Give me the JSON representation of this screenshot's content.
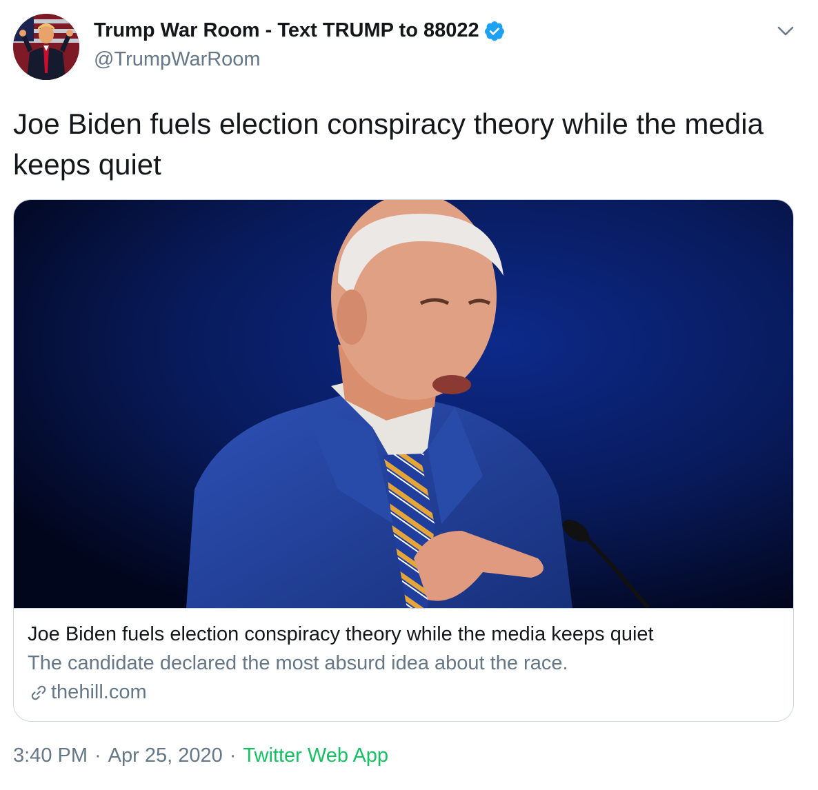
{
  "author": {
    "name": "Trump War Room - Text TRUMP to 88022",
    "handle": "@TrumpWarRoom",
    "verified": true
  },
  "icons": {
    "verified": "verified-badge-icon",
    "caret": "chevron-down-icon",
    "link": "link-icon"
  },
  "tweet": {
    "text": "Joe Biden fuels election conspiracy theory while the media keeps quiet"
  },
  "card": {
    "title": "Joe Biden fuels election conspiracy theory while the media keeps quiet",
    "description": "The candidate declared the most absurd idea about the race.",
    "domain": "thehill.com"
  },
  "meta": {
    "time": "3:40 PM",
    "separator": "·",
    "date": "Apr 25, 2020",
    "source": "Twitter Web App"
  },
  "colors": {
    "verified": "#1da1f2",
    "secondary_text": "#657786",
    "source_link": "#17bf63",
    "border": "#ccd6dd"
  }
}
